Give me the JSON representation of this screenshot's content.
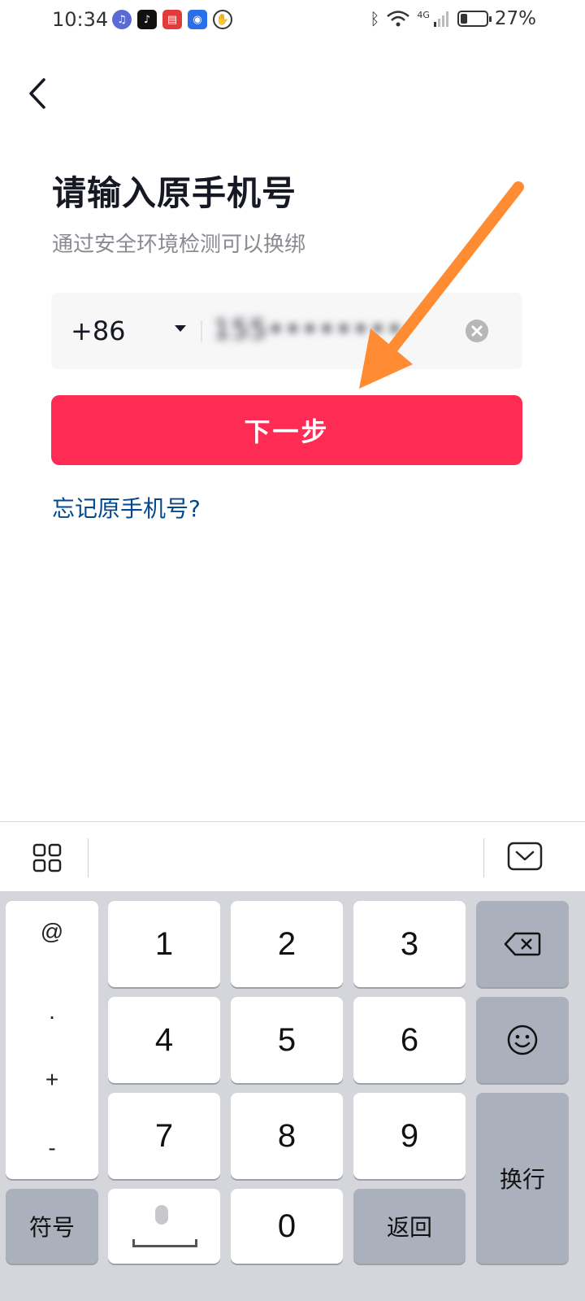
{
  "status_bar": {
    "time": "10:34",
    "app_icons": [
      "music-app-icon",
      "tiktok-app-icon",
      "reader-app-icon",
      "bulb-app-icon",
      "hand-app-icon"
    ],
    "battery_percent_label": "27%",
    "battery_level": 0.27,
    "network_label": "4G"
  },
  "header": {
    "title": "请输入原手机号",
    "subtitle": "通过安全环境检测可以换绑"
  },
  "phone_input": {
    "country_code": "+86",
    "value": "155••••••••"
  },
  "next_button_label": "下一步",
  "forgot_link": "忘记原手机号?",
  "colors": {
    "primary": "#fe2c55",
    "link": "#04498d",
    "annotation_arrow": "#ff8c32"
  },
  "keyboard": {
    "symbols": [
      "@",
      ".",
      "+",
      "-"
    ],
    "digits": [
      "1",
      "2",
      "3",
      "4",
      "5",
      "6",
      "7",
      "8",
      "9",
      "0"
    ],
    "symbols_key": "符号",
    "back_key": "返回",
    "enter_key": "换行"
  }
}
